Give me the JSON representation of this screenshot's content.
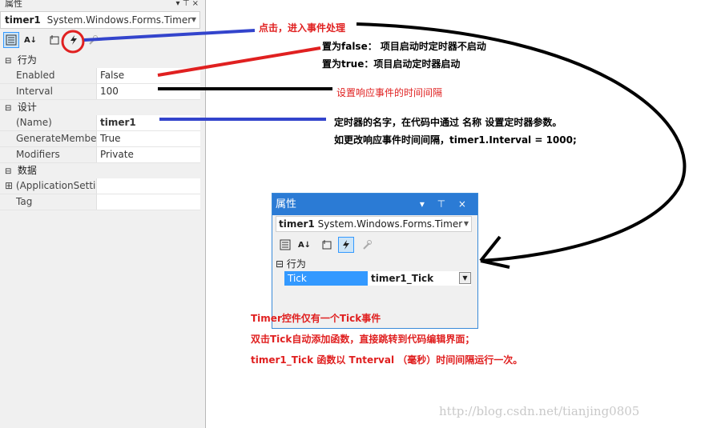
{
  "left_panel": {
    "title": "属性",
    "pin": "▾ ⊤ ×",
    "object_name": "timer1",
    "object_type": "System.Windows.Forms.Timer",
    "categories": [
      {
        "label": "行为",
        "props": [
          {
            "name": "Enabled",
            "value": "False",
            "bold": false
          },
          {
            "name": "Interval",
            "value": "100",
            "bold": false
          }
        ]
      },
      {
        "label": "设计",
        "props": [
          {
            "name": "(Name)",
            "value": "timer1",
            "bold": true
          },
          {
            "name": "GenerateMembe",
            "value": "True",
            "bold": false
          },
          {
            "name": "Modifiers",
            "value": "Private",
            "bold": false
          }
        ]
      },
      {
        "label": "数据",
        "props": [
          {
            "name": "(ApplicationSettir",
            "value": "",
            "bold": false,
            "expander": "⊞"
          },
          {
            "name": "Tag",
            "value": "",
            "bold": false
          }
        ]
      }
    ]
  },
  "annotations": {
    "events_click": "点击，进入事件处理",
    "enabled_false": "置为false： 项目启动时定时器不启动",
    "enabled_true": "置为true：项目启动定时器启动",
    "interval_note": "设置响应事件的时间间隔",
    "name_note": "定时器的名字，在代码中通过   名称   设置定时器参数。",
    "interval_code": "如更改响应事件时间间隔，timer1.Interval = 1000;",
    "tick_only": "Timer控件仅有一个Tick事件",
    "double_click": "双击Tick自动添加函数，直接跳转到代码编辑界面；",
    "tick_run": "timer1_Tick 函数以 Tnterval （毫秒）时间间隔运行一次。"
  },
  "small_window": {
    "title": "属性",
    "controls": "▾ ⊤ ×",
    "object_name": "timer1",
    "object_type": "System.Windows.Forms.Timer",
    "category": "行为",
    "event_name": "Tick",
    "event_handler": "timer1_Tick"
  },
  "watermark": "http://blog.csdn.net/tianjing0805",
  "colors": {
    "annotation_red": "#e02020",
    "line_blue": "#3344cc",
    "selection_blue": "#3399ff"
  }
}
